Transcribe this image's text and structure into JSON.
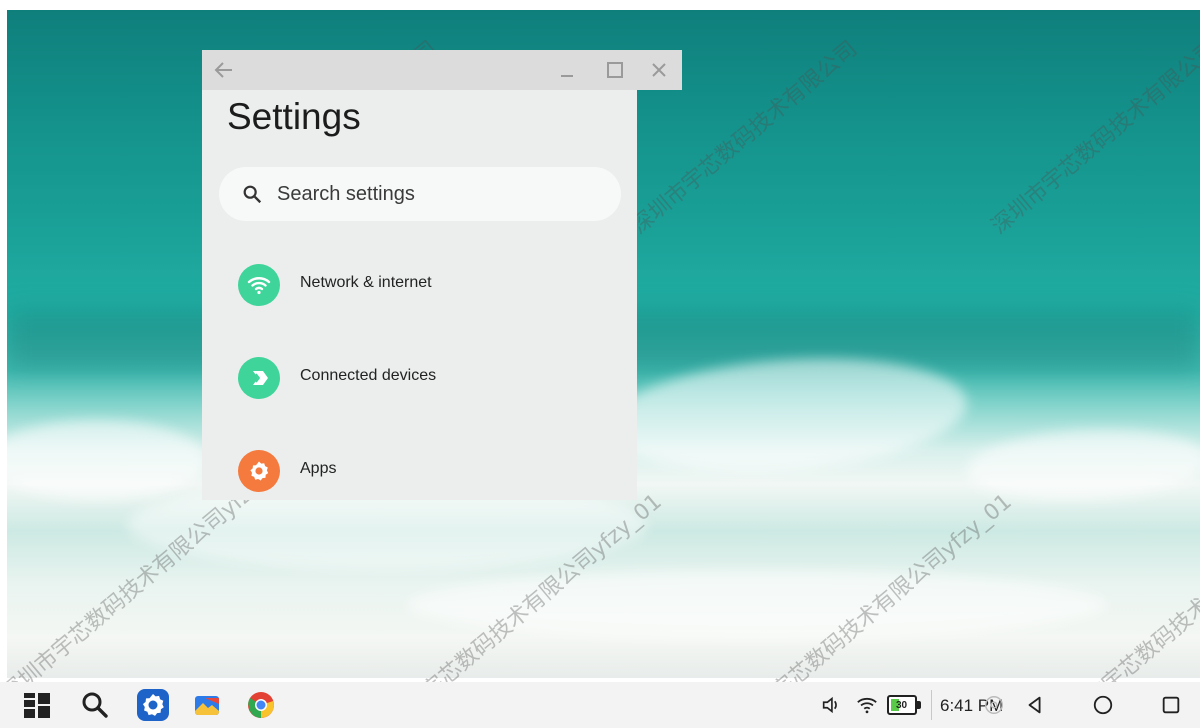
{
  "settings_window": {
    "title": "Settings",
    "search_placeholder": "Search settings",
    "items": [
      {
        "label": "Network & internet",
        "icon": "wifi-icon"
      },
      {
        "label": "Connected devices",
        "icon": "connected-devices-icon"
      },
      {
        "label": "Apps",
        "icon": "apps-gear-icon"
      }
    ]
  },
  "taskbar": {
    "apps": [
      "app-drawer-icon",
      "search-icon",
      "settings-icon",
      "files-icon",
      "chrome-icon"
    ],
    "battery_level": "30",
    "time": "6:41 PM"
  },
  "watermark": {
    "text_a": "深圳市宇芯数码技术有限公司yfzy_01",
    "text_b": "深圳市宇芯数码技术有限公司"
  },
  "colors": {
    "accent_green": "#3fd49a",
    "accent_orange": "#f47a3e",
    "settings_blue": "#1e63c8"
  }
}
